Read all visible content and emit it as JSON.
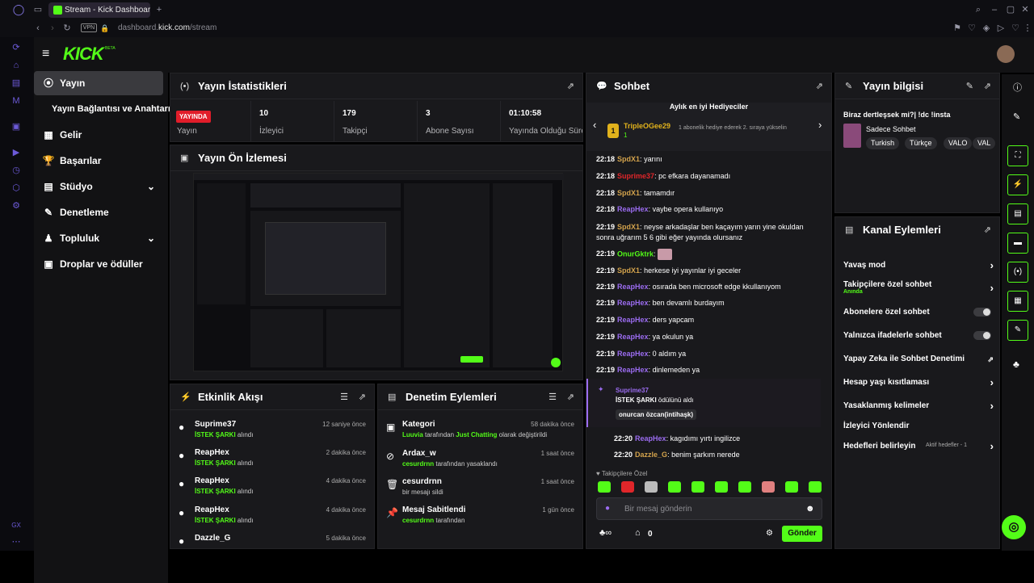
{
  "browser": {
    "tab_title": "Stream - Kick Dashboard",
    "url_prefix": "dashboard.",
    "url_host": "kick.com",
    "url_path": "/stream",
    "vpn_label": "VPN",
    "new_tab": "+"
  },
  "opera_sidebar": {
    "bottom_label": "GX"
  },
  "header": {
    "logo": "KICK",
    "logo_beta": "BETA"
  },
  "nav": {
    "items": [
      {
        "label": "Yayın",
        "icon": "broadcast-icon"
      },
      {
        "label": "Yayın Bağlantısı ve Anahtarı"
      },
      {
        "label": "Gelir",
        "icon": "revenue-icon"
      },
      {
        "label": "Başarılar",
        "icon": "trophy-icon"
      },
      {
        "label": "Stüdyo",
        "icon": "studio-icon"
      },
      {
        "label": "Denetleme",
        "icon": "wrench-icon"
      },
      {
        "label": "Topluluk",
        "icon": "community-icon"
      },
      {
        "label": "Droplar ve ödüller",
        "icon": "gift-icon"
      }
    ]
  },
  "stats": {
    "title": "Yayın İstatistikleri",
    "live_badge": "YAYINDA",
    "live_label": "Yayın",
    "items": [
      {
        "value": "10",
        "label": "İzleyici"
      },
      {
        "value": "179",
        "label": "Takipçi"
      },
      {
        "value": "3",
        "label": "Abone Sayısı"
      },
      {
        "value": "01:10:58",
        "label": "Yayında Olduğu Süre"
      }
    ]
  },
  "preview": {
    "title": "Yayın Ön İzlemesi"
  },
  "activity": {
    "title": "Etkinlik Akışı",
    "items": [
      {
        "name": "Suprime37",
        "reward": "İSTEK ŞARKI",
        "suffix": "alındı",
        "time": "12 saniye önce"
      },
      {
        "name": "ReapHex",
        "reward": "İSTEK ŞARKI",
        "suffix": "alındı",
        "time": "2 dakika önce"
      },
      {
        "name": "ReapHex",
        "reward": "İSTEK ŞARKI",
        "suffix": "alındı",
        "time": "4 dakika önce"
      },
      {
        "name": "ReapHex",
        "reward": "İSTEK ŞARKI",
        "suffix": "alındı",
        "time": "4 dakika önce"
      },
      {
        "name": "Dazzle_G",
        "reward": "",
        "suffix": "",
        "time": "5 dakika önce"
      }
    ]
  },
  "moderation": {
    "title": "Denetim Eylemleri",
    "items": [
      {
        "name": "Kategori",
        "actor": "Luuvia",
        "mid": "tarafından",
        "target": "Just Chatting",
        "rest": "olarak değiştirildi",
        "time": "58 dakika önce",
        "icon": "category-icon"
      },
      {
        "name": "Ardax_w",
        "actor": "cesurdrnn",
        "mid": "tarafından yasaklandı",
        "target": "",
        "rest": "",
        "time": "1 saat önce",
        "icon": "ban-icon"
      },
      {
        "name": "cesurdrnn",
        "actor": "",
        "mid": "bir mesajı sildi",
        "target": "",
        "rest": "",
        "time": "1 saat önce",
        "icon": "trash-icon"
      },
      {
        "name": "Mesaj Sabitlendi",
        "actor": "cesurdrnn",
        "mid": "tarafından",
        "target": "",
        "rest": "",
        "time": "1 gün önce",
        "icon": "pin-icon"
      }
    ]
  },
  "chat": {
    "title": "Sohbet",
    "gifter_heading": "Aylık en iyi Hediyeciler",
    "gifter_name": "TripleOGee29",
    "gifter_count": "1",
    "gifter_note": "1 abonelik hediye ederek 2. sıraya yükselin",
    "messages": [
      {
        "time": "22:18",
        "user": "SpdX1",
        "color": "#d2a24c",
        "text": "yarını"
      },
      {
        "time": "22:18",
        "user": "Suprime37",
        "color": "#e0262a",
        "text": "pc efkara dayanamadı"
      },
      {
        "time": "22:18",
        "user": "SpdX1",
        "color": "#d2a24c",
        "text": "tamamdır"
      },
      {
        "time": "22:18",
        "user": "ReapHex",
        "color": "#9b6cf0",
        "text": "vaybe opera kullanıyo"
      },
      {
        "time": "22:19",
        "user": "SpdX1",
        "color": "#d2a24c",
        "text": "neyse arkadaşlar ben kaçayım yarın yine okuldan sonra uğrarım 5 6 gibi eğer yayında olursanız"
      },
      {
        "time": "22:19",
        "user": "OnurGktrk",
        "color": "#53fc18",
        "text": ""
      },
      {
        "time": "22:19",
        "user": "SpdX1",
        "color": "#d2a24c",
        "text": "herkese iyi yayınlar iyi geceler"
      },
      {
        "time": "22:19",
        "user": "ReapHex",
        "color": "#9b6cf0",
        "text": "osırada ben microsoft edge kkullanıyom"
      },
      {
        "time": "22:19",
        "user": "ReapHex",
        "color": "#9b6cf0",
        "text": "ben devamlı burdayım"
      },
      {
        "time": "22:19",
        "user": "ReapHex",
        "color": "#9b6cf0",
        "text": "ders yapcam"
      },
      {
        "time": "22:19",
        "user": "ReapHex",
        "color": "#9b6cf0",
        "text": "ya okulun ya"
      },
      {
        "time": "22:19",
        "user": "ReapHex",
        "color": "#9b6cf0",
        "text": "0 aldım ya"
      },
      {
        "time": "22:19",
        "user": "ReapHex",
        "color": "#9b6cf0",
        "text": "dinlemeden ya"
      }
    ],
    "redeem": {
      "user": "Suprime37",
      "reward": "İSTEK ŞARKI",
      "suffix": "ödülünü aldı",
      "input": "onurcan özcan(intihaşk)"
    },
    "after": [
      {
        "time": "22:20",
        "user": "ReapHex",
        "color": "#9b6cf0",
        "text": "kagıdımı yırtı ingilizce"
      },
      {
        "time": "22:20",
        "user": "Dazzle_G",
        "color": "#d2a24c",
        "text": "benim şarkım nerede"
      }
    ],
    "followers_only": "Takipçilere Özel",
    "input_placeholder": "Bir mesaj gönderin",
    "points": "0",
    "send": "Gönder"
  },
  "stream_info": {
    "title": "Yayın bilgisi",
    "stream_title": "Biraz dertleşsek mi?| !dc !insta",
    "category": "Sadece Sohbet",
    "tags": [
      "Turkish",
      "Türkçe",
      "VALO",
      "VAL"
    ]
  },
  "channel_actions": {
    "title": "Kanal Eylemleri",
    "items": [
      {
        "label": "Yavaş mod",
        "kind": "arrow"
      },
      {
        "label": "Takipçilere özel sohbet",
        "sub": "Anında",
        "kind": "arrow"
      },
      {
        "label": "Abonelere özel sohbet",
        "kind": "toggle"
      },
      {
        "label": "Yalnızca ifadelerle sohbet",
        "kind": "toggle"
      },
      {
        "label": "Yapay Zeka ile Sohbet Denetimi",
        "kind": "external"
      },
      {
        "label": "Hesap yaşı kısıtlaması",
        "kind": "arrow"
      },
      {
        "label": "Yasaklanmış kelimeler",
        "kind": "arrow"
      },
      {
        "label": "İzleyici Yönlendir",
        "kind": "none"
      },
      {
        "label": "Hedefleri belirleyin",
        "extra": "Aktif hedefler - 1",
        "kind": "arrow"
      }
    ]
  },
  "colors": {
    "brand": "#53fc18",
    "live": "#e11d2a",
    "panel": "#19191c"
  }
}
